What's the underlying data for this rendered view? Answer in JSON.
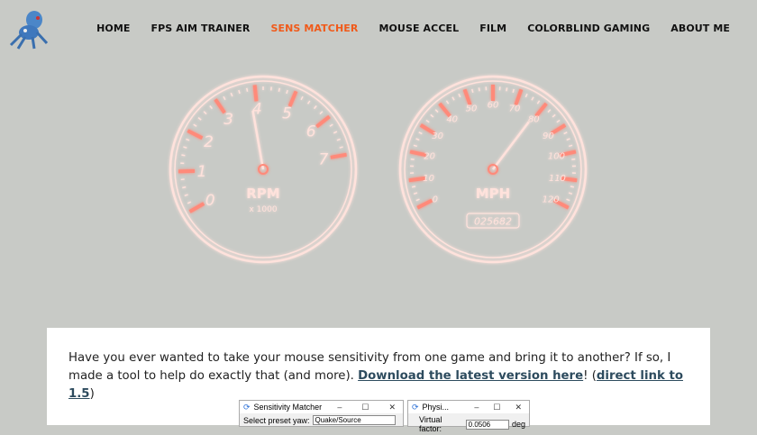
{
  "nav": {
    "items": [
      {
        "label": "HOME",
        "active": false
      },
      {
        "label": "FPS AIM TRAINER",
        "active": false
      },
      {
        "label": "SENS MATCHER",
        "active": true
      },
      {
        "label": "MOUSE ACCEL",
        "active": false
      },
      {
        "label": "FILM",
        "active": false
      },
      {
        "label": "COLORBLIND GAMING",
        "active": false
      },
      {
        "label": "ABOUT ME",
        "active": false
      }
    ]
  },
  "colors": {
    "accent": "#f05a1a",
    "gauge": "#ffe2dc",
    "glow": "#ff8a7a"
  },
  "gauges": {
    "rpm": {
      "labels": [
        "0",
        "1",
        "2",
        "3",
        "4",
        "5",
        "6",
        "7"
      ],
      "title": "RPM",
      "subtitle": "x 1000",
      "needle_value": 3.85
    },
    "mph": {
      "labels": [
        "0",
        "10",
        "20",
        "30",
        "40",
        "50",
        "60",
        "70",
        "80",
        "90",
        "100",
        "110",
        "120"
      ],
      "title": "MPH",
      "odometer": "025682",
      "needle_value": 79
    }
  },
  "intro": {
    "text1": "Have you ever wanted to take your mouse sensitivity from one game and bring it to another?  If so, I made a tool to help do exactly that (and more).  ",
    "link1": "Download the latest version here",
    "text2": "! (",
    "link2": "direct link to 1.5",
    "text3": ")"
  },
  "screenshot": {
    "win1": {
      "title": "Sensitivity Matcher",
      "preset_label": "Select preset yaw:",
      "preset_value": "Quake/Source"
    },
    "win2": {
      "title": "Physi...",
      "factor_label": "Virtual factor:",
      "factor_value": "0.0506",
      "unit": "deg"
    }
  }
}
